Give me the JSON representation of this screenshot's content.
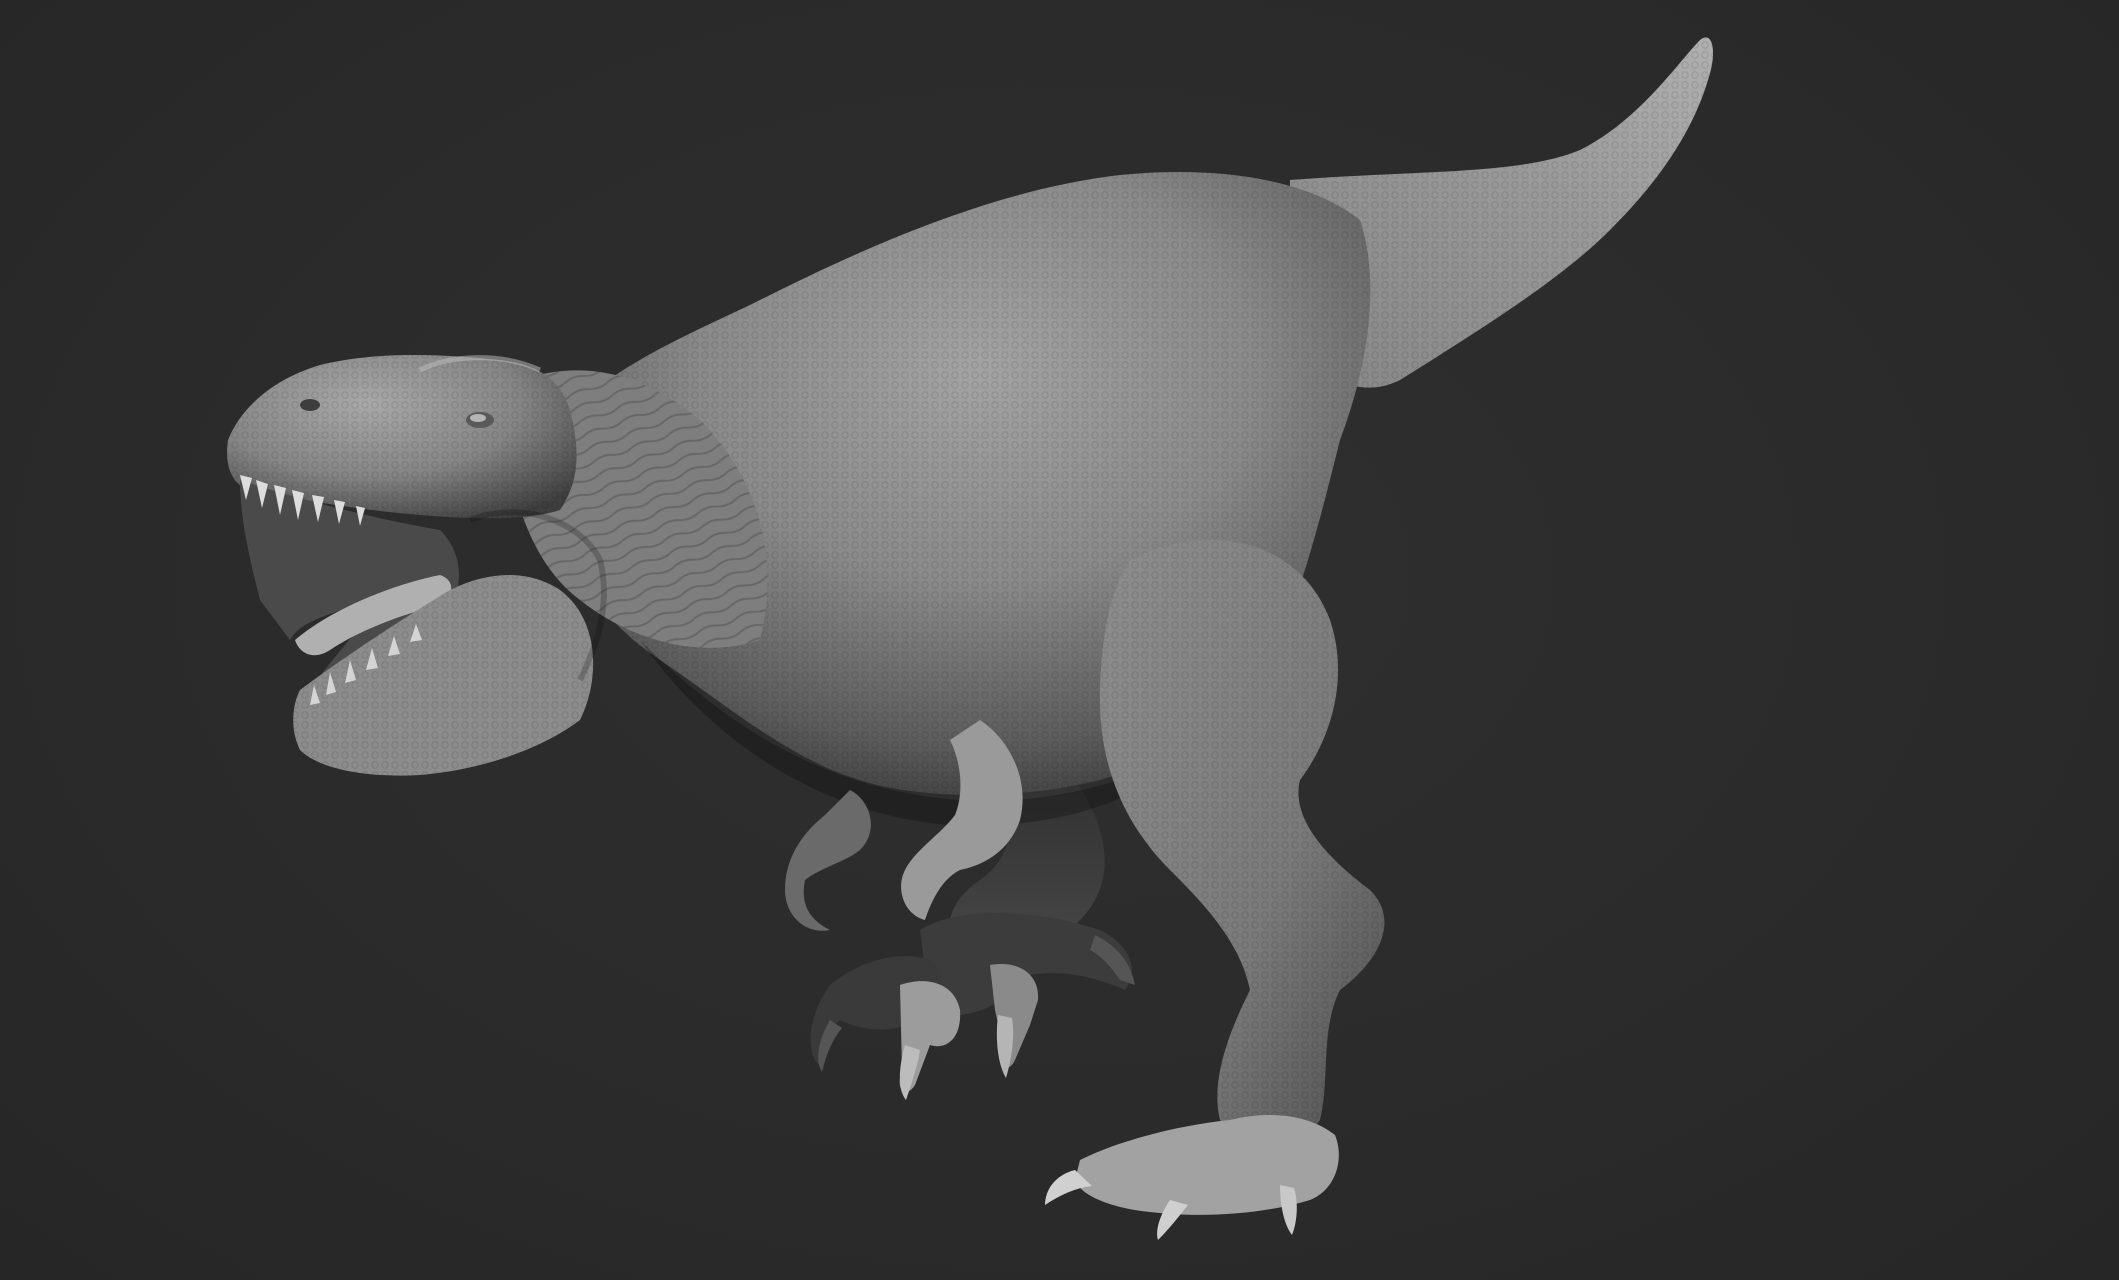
{
  "scene": {
    "background_color": "#2a2a2a",
    "subject": "trex-sculpt",
    "material_color": "#8a8a8a"
  }
}
